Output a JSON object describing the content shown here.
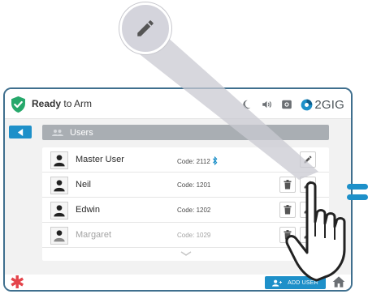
{
  "status": {
    "ready_bold": "Ready",
    "ready_rest": "to Arm",
    "brand": "2GIG",
    "icons": [
      "shield-check-icon",
      "moon-icon",
      "volume-icon",
      "camera-icon",
      "brand-logo-icon"
    ]
  },
  "header": {
    "back_icon": "back-arrow-icon",
    "title": "Users",
    "title_icon": "users-icon"
  },
  "users": [
    {
      "name": "Master User",
      "code": "Code: 2112",
      "bluetooth": true,
      "deletable": false,
      "editable": true,
      "faded": false
    },
    {
      "name": "Neil",
      "code": "Code: 1201",
      "bluetooth": false,
      "deletable": true,
      "editable": true,
      "faded": false
    },
    {
      "name": "Edwin",
      "code": "Code: 1202",
      "bluetooth": false,
      "deletable": true,
      "editable": true,
      "faded": false
    },
    {
      "name": "Margaret",
      "code": "Code: 1029",
      "bluetooth": false,
      "deletable": true,
      "editable": true,
      "faded": true
    }
  ],
  "footer": {
    "add_user_label": "ADD USER",
    "emergency_icon": "asterisk-icon",
    "home_icon": "home-icon"
  },
  "colors": {
    "accent": "#1e90c9",
    "frame": "#3f6f8e",
    "ready_green": "#26a86b",
    "emergency": "#e4444b",
    "title_bar": "#a9aeb3"
  }
}
